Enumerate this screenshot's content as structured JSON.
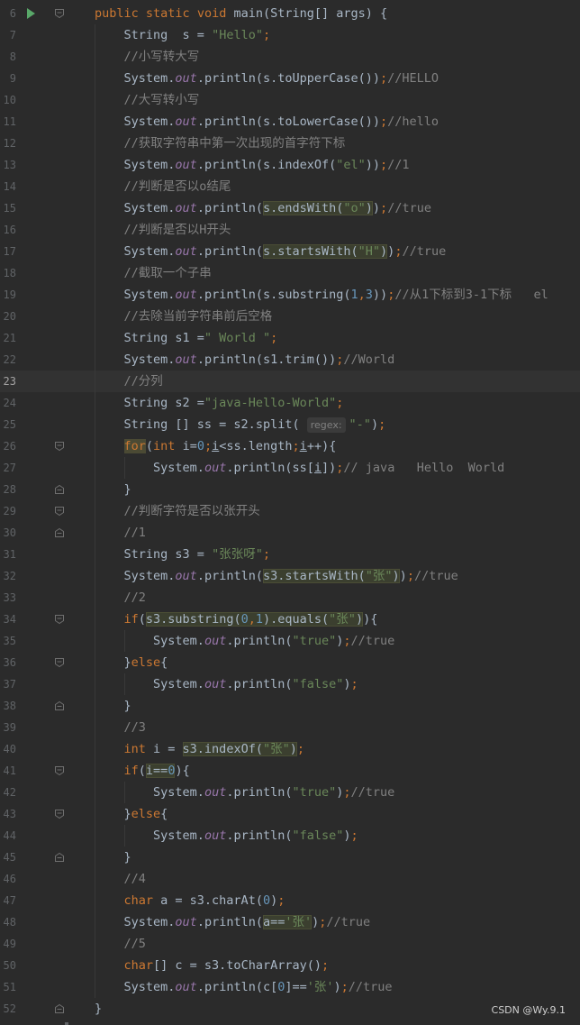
{
  "editor": {
    "lines": [
      {
        "num": "6",
        "indent": 0,
        "run": true,
        "fold": "open",
        "tokens": [
          [
            "k",
            "public "
          ],
          [
            "k",
            "static "
          ],
          [
            "k",
            "void "
          ],
          [
            "",
            "main(String[] args) {"
          ]
        ]
      },
      {
        "num": "7",
        "indent": 1,
        "tokens": [
          [
            "",
            "String  s = "
          ],
          [
            "s",
            "\"Hello\""
          ],
          [
            "k",
            ";"
          ]
        ]
      },
      {
        "num": "8",
        "indent": 1,
        "tokens": [
          [
            "c",
            "//小写转大写"
          ]
        ]
      },
      {
        "num": "9",
        "indent": 1,
        "tokens": [
          [
            "",
            "System."
          ],
          [
            "f",
            "out"
          ],
          [
            "",
            ".println(s.toUpperCase())"
          ],
          [
            "k",
            ";"
          ],
          [
            "c",
            "//HELLO"
          ]
        ]
      },
      {
        "num": "10",
        "indent": 1,
        "tokens": [
          [
            "c",
            "//大写转小写"
          ]
        ]
      },
      {
        "num": "11",
        "indent": 1,
        "tokens": [
          [
            "",
            "System."
          ],
          [
            "f",
            "out"
          ],
          [
            "",
            ".println(s.toLowerCase())"
          ],
          [
            "k",
            ";"
          ],
          [
            "c",
            "//hello"
          ]
        ]
      },
      {
        "num": "12",
        "indent": 1,
        "tokens": [
          [
            "c",
            "//获取字符串中第一次出现的首字符下标"
          ]
        ]
      },
      {
        "num": "13",
        "indent": 1,
        "tokens": [
          [
            "",
            "System."
          ],
          [
            "f",
            "out"
          ],
          [
            "",
            ".println(s.indexOf("
          ],
          [
            "s",
            "\"el\""
          ],
          [
            "",
            "))"
          ],
          [
            "k",
            ";"
          ],
          [
            "c",
            "//1"
          ]
        ]
      },
      {
        "num": "14",
        "indent": 1,
        "tokens": [
          [
            "c",
            "//判断是否以o结尾"
          ]
        ]
      },
      {
        "num": "15",
        "indent": 1,
        "tokens": [
          [
            "",
            "System."
          ],
          [
            "f",
            "out"
          ],
          [
            "",
            ".println("
          ],
          [
            "hl",
            "s.endsWith(",
            [
              [
                "s",
                "\"o\""
              ],
              [
                "",
                ")"
              ]
            ]
          ],
          [
            "",
            ")"
          ],
          [
            "k",
            ";"
          ],
          [
            "c",
            "//true"
          ]
        ]
      },
      {
        "num": "16",
        "indent": 1,
        "tokens": [
          [
            "c",
            "//判断是否以H开头"
          ]
        ]
      },
      {
        "num": "17",
        "indent": 1,
        "tokens": [
          [
            "",
            "System."
          ],
          [
            "f",
            "out"
          ],
          [
            "",
            ".println("
          ],
          [
            "hl",
            "s.startsWith(",
            [
              [
                "s",
                "\"H\""
              ],
              [
                "",
                ")"
              ]
            ]
          ],
          [
            "",
            ")"
          ],
          [
            "k",
            ";"
          ],
          [
            "c",
            "//true"
          ]
        ]
      },
      {
        "num": "18",
        "indent": 1,
        "tokens": [
          [
            "c",
            "//截取一个子串"
          ]
        ]
      },
      {
        "num": "19",
        "indent": 1,
        "tokens": [
          [
            "",
            "System."
          ],
          [
            "f",
            "out"
          ],
          [
            "",
            ".println(s.substring("
          ],
          [
            "n",
            "1"
          ],
          [
            "k",
            ","
          ],
          [
            "n",
            "3"
          ],
          [
            "",
            "))"
          ],
          [
            "k",
            ";"
          ],
          [
            "c",
            "//从1下标到3-1下标   el"
          ]
        ]
      },
      {
        "num": "20",
        "indent": 1,
        "tokens": [
          [
            "c",
            "//去除当前字符串前后空格"
          ]
        ]
      },
      {
        "num": "21",
        "indent": 1,
        "tokens": [
          [
            "",
            "String s1 ="
          ],
          [
            "s",
            "\" World \""
          ],
          [
            "k",
            ";"
          ]
        ]
      },
      {
        "num": "22",
        "indent": 1,
        "tokens": [
          [
            "",
            "System."
          ],
          [
            "f",
            "out"
          ],
          [
            "",
            ".println(s1.trim())"
          ],
          [
            "k",
            ";"
          ],
          [
            "c",
            "//World"
          ]
        ]
      },
      {
        "num": "23",
        "indent": 1,
        "current": true,
        "tokens": [
          [
            "c",
            "//分列"
          ]
        ]
      },
      {
        "num": "24",
        "indent": 1,
        "tokens": [
          [
            "",
            "String s2 ="
          ],
          [
            "s",
            "\"java-Hello-World\""
          ],
          [
            "k",
            ";"
          ]
        ]
      },
      {
        "num": "25",
        "indent": 1,
        "tokens": [
          [
            "",
            "String [] ss = s2.split( "
          ],
          [
            "hint",
            "regex:"
          ],
          [
            "s",
            "\"-\""
          ],
          [
            "",
            ")"
          ],
          [
            "k",
            ";"
          ]
        ]
      },
      {
        "num": "26",
        "indent": 1,
        "fold": "open",
        "tokens": [
          [
            "kh",
            "for"
          ],
          [
            "",
            "("
          ],
          [
            "k",
            "int "
          ],
          [
            "",
            "i="
          ],
          [
            "n",
            "0"
          ],
          [
            "k",
            ";"
          ],
          [
            "u",
            "i"
          ],
          [
            "",
            "<ss.length"
          ],
          [
            "k",
            ";"
          ],
          [
            "u",
            "i"
          ],
          [
            "",
            "++){"
          ]
        ]
      },
      {
        "num": "27",
        "indent": 2,
        "tokens": [
          [
            "",
            "System."
          ],
          [
            "f",
            "out"
          ],
          [
            "",
            ".println(ss["
          ],
          [
            "u",
            "i"
          ],
          [
            "",
            "])"
          ],
          [
            "k",
            ";"
          ],
          [
            "c",
            "// java   Hello  World"
          ]
        ]
      },
      {
        "num": "28",
        "indent": 1,
        "fold": "close",
        "tokens": [
          [
            "",
            "}"
          ]
        ]
      },
      {
        "num": "29",
        "indent": 1,
        "fold": "open",
        "tokens": [
          [
            "c",
            "//判断字符是否以张开头"
          ]
        ]
      },
      {
        "num": "30",
        "indent": 1,
        "fold": "close",
        "tokens": [
          [
            "c",
            "//1"
          ]
        ]
      },
      {
        "num": "31",
        "indent": 1,
        "tokens": [
          [
            "",
            "String s3 = "
          ],
          [
            "s",
            "\"张张呀\""
          ],
          [
            "k",
            ";"
          ]
        ]
      },
      {
        "num": "32",
        "indent": 1,
        "tokens": [
          [
            "",
            "System."
          ],
          [
            "f",
            "out"
          ],
          [
            "",
            ".println("
          ],
          [
            "hl",
            "s3.startsWith(",
            [
              [
                "s",
                "\"张\""
              ],
              [
                "",
                ")"
              ]
            ]
          ],
          [
            "",
            ")"
          ],
          [
            "k",
            ";"
          ],
          [
            "c",
            "//true"
          ]
        ]
      },
      {
        "num": "33",
        "indent": 1,
        "tokens": [
          [
            "c",
            "//2"
          ]
        ]
      },
      {
        "num": "34",
        "indent": 1,
        "fold": "open",
        "tokens": [
          [
            "k",
            "if"
          ],
          [
            "",
            "("
          ],
          [
            "hl",
            "s3.substring(",
            [
              [
                "n",
                "0"
              ],
              [
                "k",
                ","
              ],
              [
                "n",
                "1"
              ],
              [
                "",
                ").equals("
              ],
              [
                "s",
                "\"张\""
              ],
              [
                "",
                ")"
              ]
            ]
          ],
          [
            "",
            "){"
          ]
        ]
      },
      {
        "num": "35",
        "indent": 2,
        "tokens": [
          [
            "",
            "System."
          ],
          [
            "f",
            "out"
          ],
          [
            "",
            ".println("
          ],
          [
            "s",
            "\"true\""
          ],
          [
            "",
            ")"
          ],
          [
            "k",
            ";"
          ],
          [
            "c",
            "//true"
          ]
        ]
      },
      {
        "num": "36",
        "indent": 1,
        "fold": "mid",
        "tokens": [
          [
            "",
            "}"
          ],
          [
            "k",
            "else"
          ],
          [
            "",
            "{"
          ]
        ]
      },
      {
        "num": "37",
        "indent": 2,
        "tokens": [
          [
            "",
            "System."
          ],
          [
            "f",
            "out"
          ],
          [
            "",
            ".println("
          ],
          [
            "s",
            "\"false\""
          ],
          [
            "",
            ")"
          ],
          [
            "k",
            ";"
          ]
        ]
      },
      {
        "num": "38",
        "indent": 1,
        "fold": "close",
        "tokens": [
          [
            "",
            "}"
          ]
        ]
      },
      {
        "num": "39",
        "indent": 1,
        "tokens": [
          [
            "c",
            "//3"
          ]
        ]
      },
      {
        "num": "40",
        "indent": 1,
        "tokens": [
          [
            "k",
            "int "
          ],
          [
            "",
            "i = "
          ],
          [
            "hl",
            "s3.indexOf(",
            [
              [
                "s",
                "\"张\""
              ],
              [
                "",
                ")"
              ]
            ]
          ],
          [
            "k",
            ";"
          ]
        ]
      },
      {
        "num": "41",
        "indent": 1,
        "fold": "open",
        "tokens": [
          [
            "k",
            "if"
          ],
          [
            "",
            "("
          ],
          [
            "hl",
            "i==",
            [
              [
                "n",
                "0"
              ]
            ]
          ],
          [
            "",
            "){"
          ]
        ]
      },
      {
        "num": "42",
        "indent": 2,
        "tokens": [
          [
            "",
            "System."
          ],
          [
            "f",
            "out"
          ],
          [
            "",
            ".println("
          ],
          [
            "s",
            "\"true\""
          ],
          [
            "",
            ")"
          ],
          [
            "k",
            ";"
          ],
          [
            "c",
            "//true"
          ]
        ]
      },
      {
        "num": "43",
        "indent": 1,
        "fold": "mid",
        "tokens": [
          [
            "",
            "}"
          ],
          [
            "k",
            "else"
          ],
          [
            "",
            "{"
          ]
        ]
      },
      {
        "num": "44",
        "indent": 2,
        "tokens": [
          [
            "",
            "System."
          ],
          [
            "f",
            "out"
          ],
          [
            "",
            ".println("
          ],
          [
            "s",
            "\"false\""
          ],
          [
            "",
            ")"
          ],
          [
            "k",
            ";"
          ]
        ]
      },
      {
        "num": "45",
        "indent": 1,
        "fold": "close",
        "tokens": [
          [
            "",
            "}"
          ]
        ]
      },
      {
        "num": "46",
        "indent": 1,
        "tokens": [
          [
            "c",
            "//4"
          ]
        ]
      },
      {
        "num": "47",
        "indent": 1,
        "tokens": [
          [
            "k",
            "char "
          ],
          [
            "",
            "a = s3.charAt("
          ],
          [
            "n",
            "0"
          ],
          [
            "",
            ")"
          ],
          [
            "k",
            ";"
          ]
        ]
      },
      {
        "num": "48",
        "indent": 1,
        "tokens": [
          [
            "",
            "System."
          ],
          [
            "f",
            "out"
          ],
          [
            "",
            ".println("
          ],
          [
            "hl",
            "a==",
            [
              [
                "s",
                "'张'"
              ]
            ]
          ],
          [
            "",
            ")"
          ],
          [
            "k",
            ";"
          ],
          [
            "c",
            "//true"
          ]
        ]
      },
      {
        "num": "49",
        "indent": 1,
        "tokens": [
          [
            "c",
            "//5"
          ]
        ]
      },
      {
        "num": "50",
        "indent": 1,
        "tokens": [
          [
            "k",
            "char"
          ],
          [
            "",
            "[] c = s3.toCharArray()"
          ],
          [
            "k",
            ";"
          ]
        ]
      },
      {
        "num": "51",
        "indent": 1,
        "tokens": [
          [
            "",
            "System."
          ],
          [
            "f",
            "out"
          ],
          [
            "",
            ".println(c["
          ],
          [
            "n",
            "0"
          ],
          [
            "",
            "]=="
          ],
          [
            "s",
            "'张'"
          ],
          [
            "",
            ")"
          ],
          [
            "k",
            ";"
          ],
          [
            "c",
            "//true"
          ]
        ]
      },
      {
        "num": "52",
        "indent": 0,
        "fold": "close",
        "tokens": [
          [
            "",
            "}"
          ]
        ]
      }
    ]
  },
  "watermark": "CSDN @Wy.9.1",
  "colors": {
    "background": "#2b2b2b",
    "current_line": "#323232",
    "keyword": "#cc7832",
    "string": "#6a8759",
    "number": "#6897bb",
    "comment": "#808080",
    "static_field": "#9876aa",
    "run_icon": "#59a869"
  }
}
